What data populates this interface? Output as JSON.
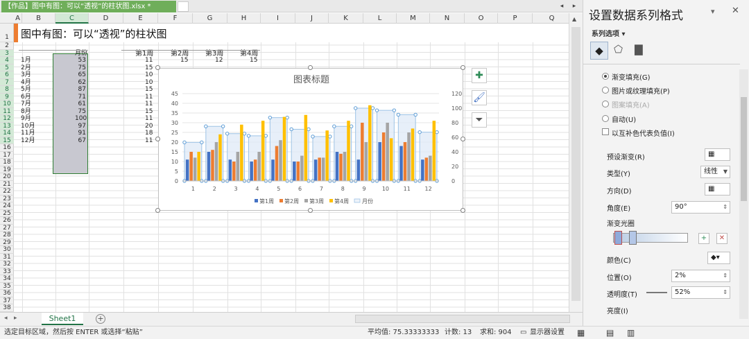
{
  "tab": {
    "filename": "【作品】图中有图：可以“透视”的柱状图.xlsx *",
    "close": "×"
  },
  "columns": [
    "A",
    "B",
    "C",
    "D",
    "E",
    "F",
    "G",
    "H",
    "I",
    "J",
    "K",
    "L",
    "M",
    "N",
    "O",
    "P",
    "Q"
  ],
  "rows": [
    "1",
    "2",
    "3",
    "4",
    "5",
    "6",
    "7",
    "8",
    "9",
    "10",
    "11",
    "12",
    "13",
    "14",
    "15",
    "16",
    "17",
    "18",
    "19",
    "20",
    "21",
    "22",
    "23",
    "24",
    "25",
    "26",
    "27",
    "28",
    "29",
    "30",
    "31",
    "32",
    "33",
    "34",
    "35",
    "36",
    "37",
    "38",
    "39",
    "40"
  ],
  "sheet_title": "图中有图：可以“透视”的柱状图",
  "left_table": {
    "header": "月份",
    "months": [
      "1月",
      "2月",
      "3月",
      "4月",
      "5月",
      "6月",
      "7月",
      "8月",
      "9月",
      "10月",
      "11月",
      "12月"
    ],
    "values": [
      "53",
      "75",
      "65",
      "62",
      "87",
      "71",
      "61",
      "75",
      "100",
      "97",
      "91",
      "67"
    ]
  },
  "week_table": {
    "headers": [
      "第1周",
      "第2周",
      "第3周",
      "第4周"
    ],
    "first_row": [
      "11",
      "15",
      "12",
      "15"
    ],
    "col1": [
      "11",
      "15",
      "10",
      "10",
      "15",
      "11",
      "11",
      "15",
      "11",
      "20",
      "18",
      "11"
    ]
  },
  "chart_data": {
    "type": "bar",
    "title": "图表标题",
    "categories": [
      "1",
      "2",
      "3",
      "4",
      "5",
      "6",
      "7",
      "8",
      "9",
      "10",
      "11",
      "12"
    ],
    "series": [
      {
        "name": "第1周",
        "values": [
          11,
          15,
          11,
          10,
          11,
          10,
          11,
          15,
          11,
          20,
          18,
          11
        ],
        "color": "#4472c4"
      },
      {
        "name": "第2周",
        "values": [
          15,
          16,
          10,
          11,
          18,
          10,
          12,
          14,
          30,
          25,
          20,
          12
        ],
        "color": "#ed7d31"
      },
      {
        "name": "第3周",
        "values": [
          12,
          20,
          15,
          15,
          21,
          13,
          12,
          15,
          20,
          30,
          25,
          13
        ],
        "color": "#a5a5a5"
      },
      {
        "name": "第4周",
        "values": [
          15,
          24,
          29,
          31,
          33,
          34,
          26,
          31,
          39,
          22,
          27,
          31
        ],
        "color": "#ffc000"
      }
    ],
    "secondary_series": {
      "name": "月份",
      "values": [
        53,
        75,
        65,
        62,
        87,
        71,
        61,
        75,
        100,
        97,
        91,
        67
      ]
    },
    "y_ticks": [
      "0",
      "5",
      "10",
      "15",
      "20",
      "25",
      "30",
      "35",
      "40",
      "45"
    ],
    "y2_ticks": [
      "0",
      "20",
      "40",
      "60",
      "80",
      "100",
      "120"
    ],
    "ylim": [
      0,
      45
    ],
    "y2lim": [
      0,
      120
    ],
    "legend_position": "bottom"
  },
  "sheet": {
    "name": "Sheet1"
  },
  "status": {
    "message": "选定目标区域，然后按 ENTER 或选择“粘贴”",
    "average": "平均值: 75.33333333",
    "count": "计数: 13",
    "sum": "求和: 904",
    "display": "显示器设置"
  },
  "pane": {
    "title": "设置数据系列格式",
    "section": "系列选项",
    "fill_options": [
      "渐变填充(G)",
      "图片或纹理填充(P)",
      "图案填充(A)",
      "自动(U)"
    ],
    "invert": "以互补色代表负值(I)",
    "preset": "预设渐变(R)",
    "type_label": "类型(Y)",
    "type_value": "线性",
    "direction": "方向(D)",
    "angle_label": "角度(E)",
    "angle_value": "90°",
    "stops": "渐变光圈",
    "color_label": "颜色(C)",
    "position_label": "位置(O)",
    "position_value": "2%",
    "transparency_label": "透明度(T)",
    "transparency_value": "52%",
    "brightness_label": "亮度(I)"
  },
  "colors": {
    "excel_green": "#217346",
    "accent_orange": "#ed7d31"
  }
}
